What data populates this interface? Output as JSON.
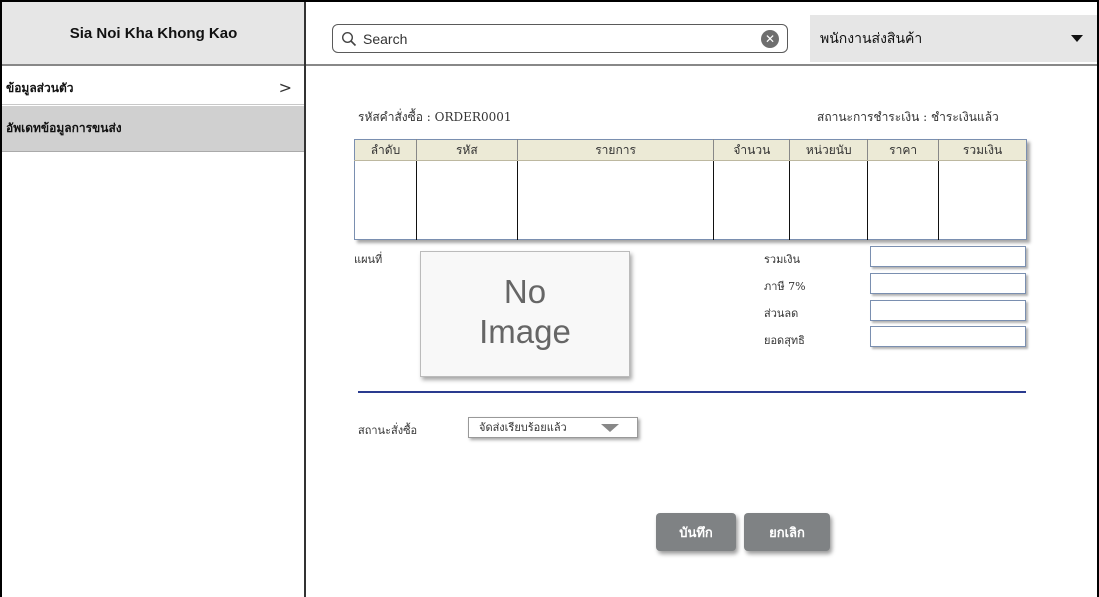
{
  "app": {
    "title": "Sia Noi Kha Khong Kao"
  },
  "sidebar": {
    "items": [
      {
        "label": "ข้อมูลส่วนตัว",
        "chevron": ">"
      },
      {
        "label": "อัพเดทข้อมูลการขนส่ง"
      }
    ]
  },
  "header": {
    "search": {
      "placeholder": "Search"
    },
    "role": "พนักงานส่งสินค้า"
  },
  "order": {
    "id_label": "รหัสคำสั่งซื้อ : ORDER0001",
    "payment_status": "สถานะการชำระเงิน : ชำระเงินแล้ว"
  },
  "table": {
    "columns": [
      "ลำดับ",
      "รหัส",
      "รายการ",
      "จำนวน",
      "หน่วยนับ",
      "ราคา",
      "รวมเงิน"
    ],
    "rows": []
  },
  "map": {
    "label": "แผนที่",
    "placeholder_line1": "No",
    "placeholder_line2": "Image"
  },
  "summary": {
    "total_label": "รวมเงิน",
    "vat_label": "ภาษี 7%",
    "discount_label": "ส่วนลด",
    "net_label": "ยอดสุทธิ",
    "total_value": "",
    "vat_value": "",
    "discount_value": "",
    "net_value": ""
  },
  "status": {
    "label": "สถานะสั่งซื้อ",
    "selected": "จัดส่งเรียบร้อยแล้ว"
  },
  "buttons": {
    "save": "บันทึก",
    "cancel": "ยกเลิก"
  },
  "icons": {
    "search": "search-icon",
    "clear": "clear-icon",
    "dropdown": "chevron-down-icon"
  }
}
